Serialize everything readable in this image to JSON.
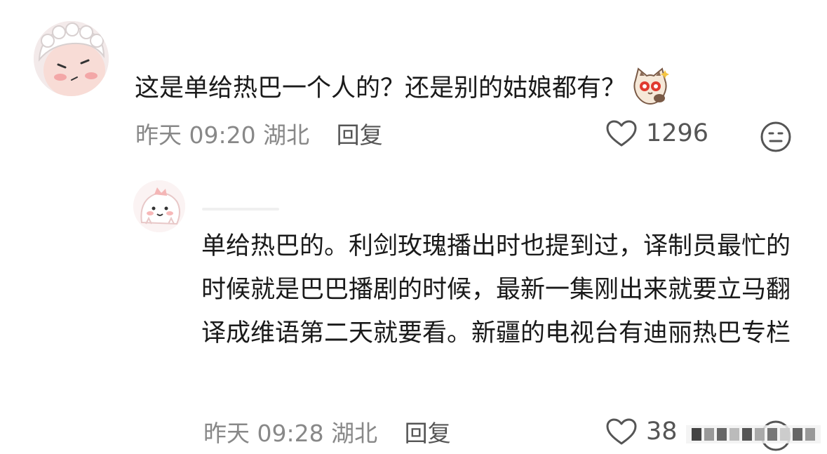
{
  "comment": {
    "text": "这是单给热巴一个人的？还是别的姑娘都有？",
    "time": "昨天 09:20",
    "location": "湖北",
    "reply_label": "回复",
    "likes": "1296",
    "sticker_icon": "cat-sticker-icon"
  },
  "reply": {
    "text": "单给热巴的。利剑玫瑰播出时也提到过，译制员最忙的时候就是巴巴播剧的时候，最新一集刚出来就要立马翻译成维语第二天就要看。新疆的电视台有迪丽热巴专栏",
    "time": "昨天 09:28",
    "location": "湖北",
    "reply_label": "回复",
    "likes": "38"
  },
  "colors": {
    "text": "#1a1a1a",
    "meta": "#888888",
    "action": "#555555"
  }
}
